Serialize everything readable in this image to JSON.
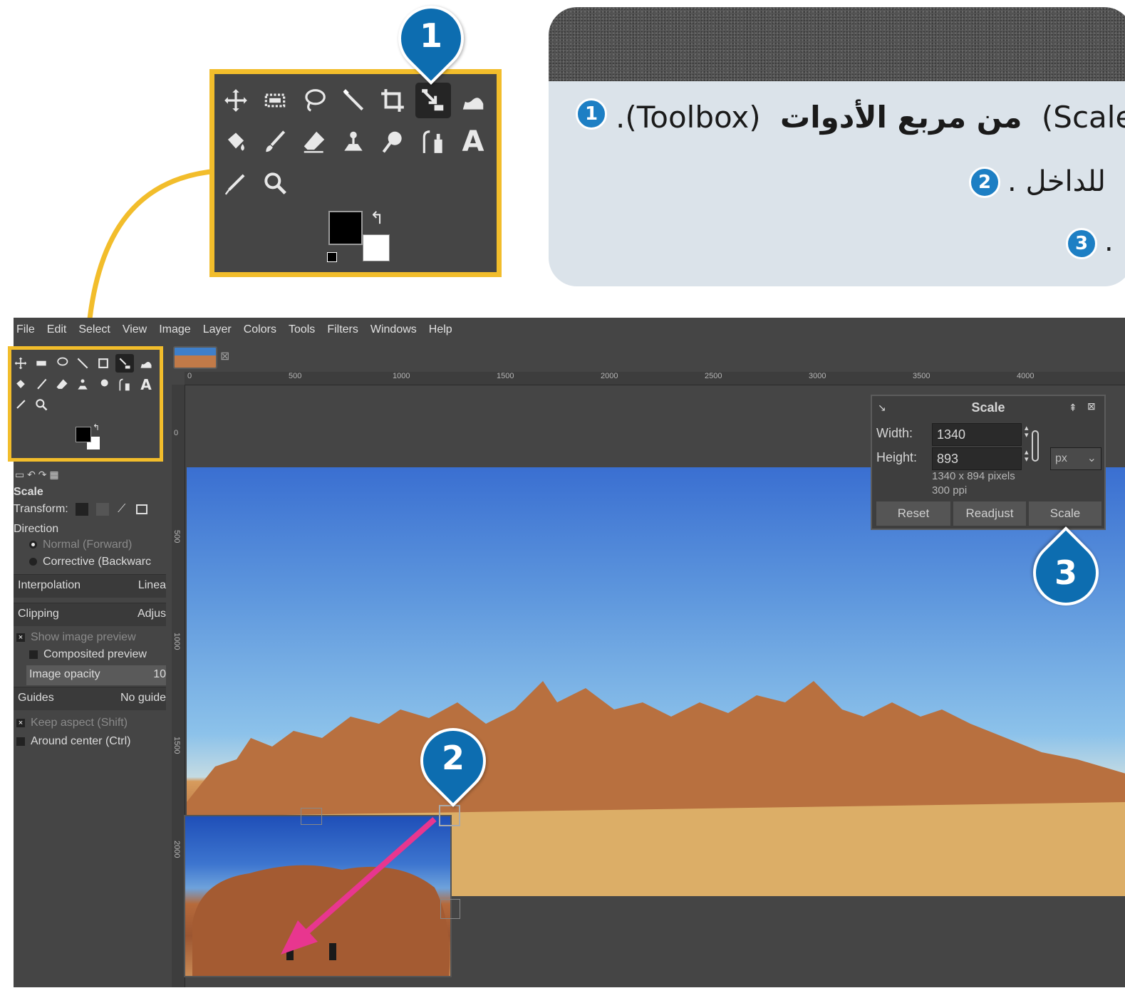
{
  "instructions": {
    "line1_plain": ".(Toolbox)",
    "line1_bold": "من مربع الأدوات",
    "line1_end": "(Scale To",
    "line2": ". للداخل",
    "line3": ".",
    "badges": [
      "1",
      "2",
      "3"
    ]
  },
  "callouts": [
    "1",
    "2",
    "3"
  ],
  "menubar": [
    "File",
    "Edit",
    "Select",
    "View",
    "Image",
    "Layer",
    "Colors",
    "Tools",
    "Filters",
    "Windows",
    "Help"
  ],
  "toolbox": {
    "tools": [
      "move-tool",
      "rect-select-tool",
      "free-select-tool",
      "fuzzy-select-tool",
      "crop-tool",
      "scale-tool",
      "warp-tool",
      "bucket-fill-tool",
      "paintbrush-tool",
      "eraser-tool",
      "clone-tool",
      "smudge-tool",
      "paths-tool",
      "text-tool",
      "color-picker-tool",
      "zoom-tool"
    ],
    "active_tool": "scale-tool",
    "fg_color": "#000000",
    "bg_color": "#ffffff"
  },
  "tool_options": {
    "title": "Scale",
    "transform_label": "Transform:",
    "direction_label": "Direction",
    "direction_options": [
      "Normal (Forward)",
      "Corrective (Backwarc"
    ],
    "interpolation_label": "Interpolation",
    "interpolation_value": "Linea",
    "clipping_label": "Clipping",
    "clipping_value": "Adjus",
    "show_preview": "Show image preview",
    "composited_preview": "Composited preview",
    "image_opacity_label": "Image opacity",
    "image_opacity_value": "10",
    "guides_label": "Guides",
    "guides_value": "No guide",
    "keep_aspect": "Keep aspect (Shift)",
    "around_center": "Around center (Ctrl)"
  },
  "rulers": {
    "top_ticks": [
      "0",
      "500",
      "1000",
      "1500",
      "2000",
      "2500",
      "3000",
      "3500",
      "4000"
    ],
    "left_ticks": [
      "0",
      "500",
      "1000",
      "1500",
      "2000"
    ]
  },
  "scale_dialog": {
    "title": "Scale",
    "width_label": "Width:",
    "width_value": "1340",
    "height_label": "Height:",
    "height_value": "893",
    "unit": "px",
    "size_info": "1340 x 894 pixels",
    "resolution_info": "300 ppi",
    "buttons": [
      "Reset",
      "Readjust",
      "Scale"
    ]
  },
  "colors": {
    "highlight": "#f2bd2b",
    "callout_blue": "#0d6db0",
    "badge_blue": "#1d7fc4",
    "arrow_pink": "#e8368f"
  }
}
